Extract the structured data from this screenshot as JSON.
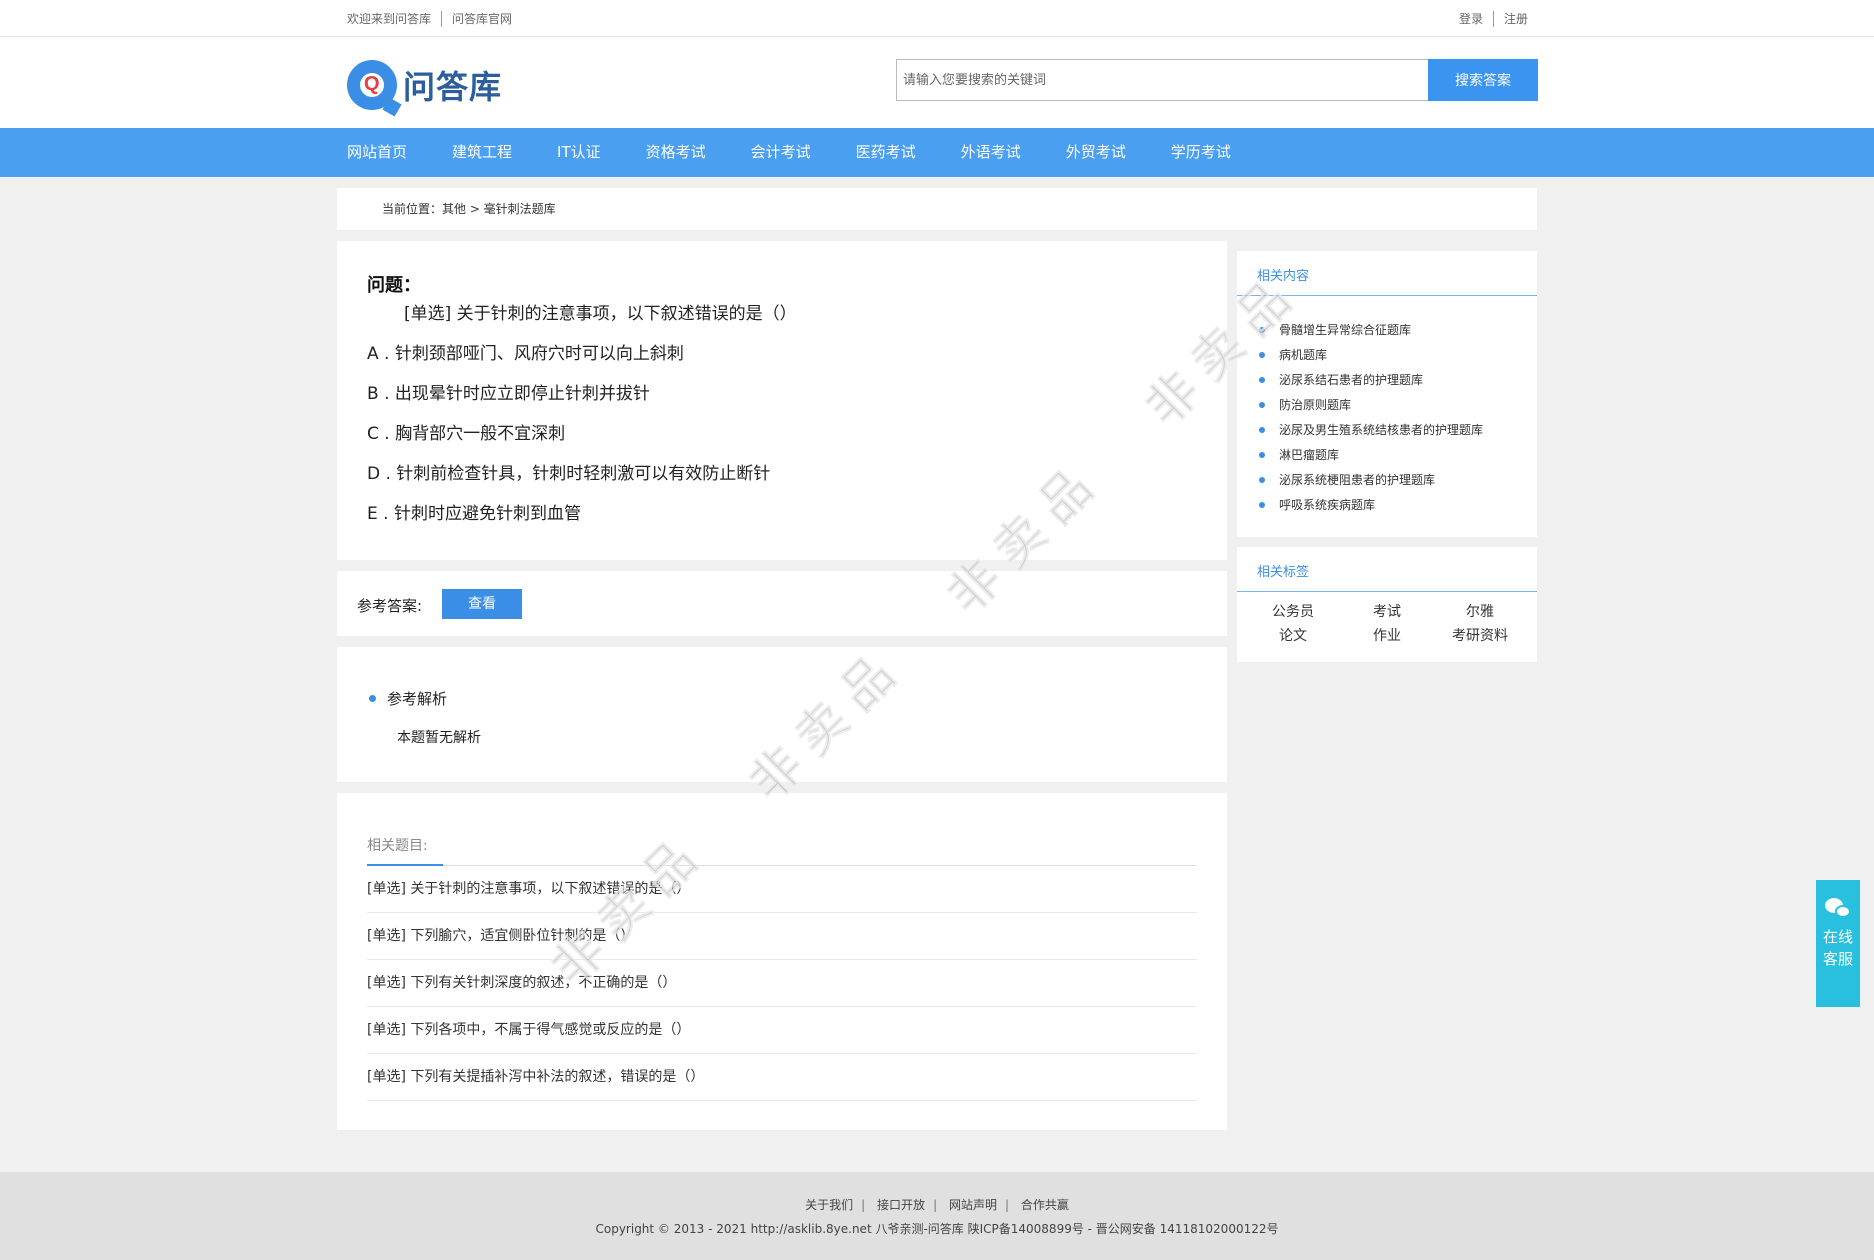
{
  "topbar": {
    "welcome": "欢迎来到问答库",
    "official": "问答库官网",
    "login": "登录",
    "register": "注册"
  },
  "header": {
    "logo_text": "问答库",
    "search_placeholder": "请输入您要搜索的关键词",
    "search_button": "搜索答案"
  },
  "nav": [
    "网站首页",
    "建筑工程",
    "IT认证",
    "资格考试",
    "会计考试",
    "医药考试",
    "外语考试",
    "外贸考试",
    "学历考试"
  ],
  "breadcrumb": "当前位置：其他 > 毫针刺法题库",
  "question": {
    "title": "问题：",
    "stem": "[单选] 关于针刺的注意事项，以下叙述错误的是（）",
    "options": [
      "A . 针刺颈部哑门、风府穴时可以向上斜刺",
      "B . 出现晕针时应立即停止针刺并拔针",
      "C . 胸背部穴一般不宜深刺",
      "D . 针刺前检查针具，针刺时轻刺激可以有效防止断针",
      "E . 针刺时应避免针刺到血管"
    ]
  },
  "answer": {
    "label": "参考答案:",
    "button": "查看"
  },
  "explanation": {
    "title": "参考解析",
    "body": "本题暂无解析"
  },
  "related_questions": {
    "heading": "相关题目:",
    "items": [
      "[单选] 关于针刺的注意事项，以下叙述错误的是（）",
      "[单选] 下列腧穴，适宜侧卧位针刺的是（）",
      "[单选] 下列有关针刺深度的叙述，不正确的是（）",
      "[单选] 下列各项中，不属于得气感觉或反应的是（）",
      "[单选] 下列有关提插补泻中补法的叙述，错误的是（）"
    ]
  },
  "sidebar": {
    "related_heading": "相关内容",
    "related_items": [
      "骨髓增生异常综合征题库",
      "病机题库",
      "泌尿系结石患者的护理题库",
      "防治原则题库",
      "泌尿及男生殖系统结核患者的护理题库",
      "淋巴瘤题库",
      "泌尿系统梗阻患者的护理题库",
      "呼吸系统疾病题库"
    ],
    "tags_heading": "相关标签",
    "tags": [
      "公务员",
      "考试",
      "尔雅",
      "论文",
      "作业",
      "考研资料"
    ]
  },
  "footer": {
    "links": [
      "关于我们",
      "接口开放",
      "网站声明",
      "合作共赢"
    ],
    "copyright": "Copyright © 2013 - 2021 http://asklib.8ye.net  八爷亲测-问答库   陕ICP备14008899号 - 晋公网安备 14118102000122号"
  },
  "kefu": {
    "line1": "在线",
    "line2": "客服"
  },
  "watermark": "非卖品"
}
